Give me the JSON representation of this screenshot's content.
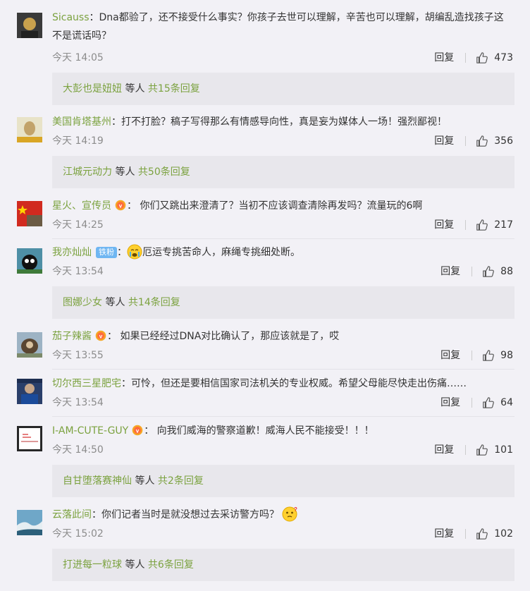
{
  "comments": [
    {
      "user": "Sicauss",
      "text": "Dna都验了，还不接受什么事实？你孩子去世可以理解，辛苦也可以理解，胡编乱造找孩子这不是谎话吗？",
      "time": "今天 14:05",
      "reply": "回复",
      "likes": "473",
      "sub": {
        "user": "大彭也是妞妞",
        "mid": "等人",
        "count": "共15条回复"
      }
    },
    {
      "user": "美国肯塔基州",
      "text": "打不打脸？稿子写得那么有情感导向性，真是妄为媒体人一场！强烈鄙视！",
      "time": "今天 14:19",
      "reply": "回复",
      "likes": "356",
      "sub": {
        "user": "江城元动力",
        "mid": "等人",
        "count": "共50条回复"
      }
    },
    {
      "user": "星火、宣传员",
      "text": "你们又跳出来澄清了？当初不应该调查清除再发吗？流量玩的6啊",
      "time": "今天 14:25",
      "reply": "回复",
      "likes": "217"
    },
    {
      "user": "我亦灿灿",
      "badge": "铁粉",
      "text": "厄运专挑苦命人，麻绳专挑细处断。",
      "time": "今天 13:54",
      "reply": "回复",
      "likes": "88",
      "sub": {
        "user": "图娜少女",
        "mid": "等人",
        "count": "共14条回复"
      }
    },
    {
      "user": "茄子辣酱",
      "text": "如果已经经过DNA对比确认了，那应该就是了，哎",
      "time": "今天 13:55",
      "reply": "回复",
      "likes": "98"
    },
    {
      "user": "切尔西三星肥宅",
      "text": "可怜，但还是要相信国家司法机关的专业权威。希望父母能尽快走出伤痛……",
      "time": "今天 13:54",
      "reply": "回复",
      "likes": "64"
    },
    {
      "user": "I-AM-CUTE-GUY",
      "text": "向我们威海的警察道歉！威海人民不能接受！！！",
      "time": "今天 14:50",
      "reply": "回复",
      "likes": "101",
      "sub": {
        "user": "自甘堕落赛神仙",
        "mid": "等人",
        "count": "共2条回复"
      }
    },
    {
      "user": "云落此间",
      "text": "你们记者当时是就没想过去采访警方吗？",
      "time": "今天 15:02",
      "reply": "回复",
      "likes": "102",
      "sub": {
        "user": "打进每一粒球",
        "mid": "等人",
        "count": "共6条回复"
      }
    }
  ],
  "colors": {
    "username": "#7ba23f",
    "background": "#f2f1f6",
    "subbox": "#e8e7ec",
    "fan_badge": "#6fb6f2"
  },
  "icons": {
    "like": "thumbs-up-icon",
    "vip": "vip-badge-icon",
    "emoji_cry": "crying-face-icon",
    "emoji_think": "thinking-face-icon"
  }
}
